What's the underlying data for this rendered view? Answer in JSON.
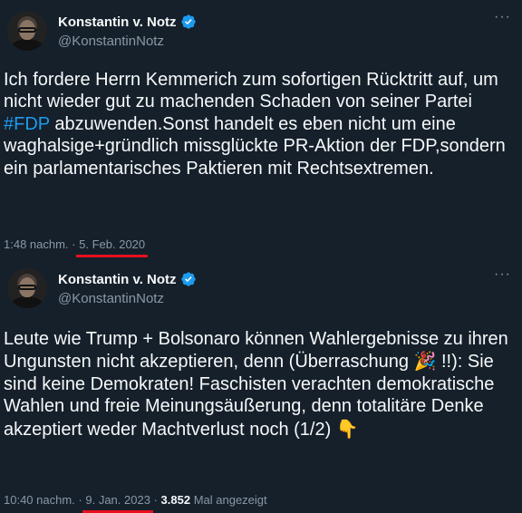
{
  "tweets": [
    {
      "author_name": "Konstantin v. Notz",
      "handle": "@KonstantinNotz",
      "more": "···",
      "text_part1": "Ich fordere Herrn Kemmerich zum sofortigen Rücktritt auf, um nicht wieder gut zu machenden Schaden von seiner Partei ",
      "hashtag": "#FDP",
      "text_part2": " abzuwenden.Sonst handelt es eben nicht um eine waghalsige+gründlich missglückte PR-Aktion der FDP,sondern ein parlamentarisches Paktieren mit Rechtsextremen.",
      "time": "1:48 nachm.",
      "sep": "·",
      "date": "5. Feb. 2020"
    },
    {
      "author_name": "Konstantin v. Notz",
      "handle": "@KonstantinNotz",
      "more": "···",
      "text_part1": "Leute wie Trump + Bolsonaro können Wahlergebnisse zu ihren Ungunsten nicht akzeptieren, denn (Überraschung ",
      "emoji1": "🎉",
      "text_part2": " !!): Sie sind keine Demokraten! Faschisten verachten demokratische Wahlen und freie Meinungsäußerung, denn totalitäre Denke akzeptiert weder Machtverlust noch (1/2) ",
      "emoji2": "👇",
      "time": "10:40 nachm.",
      "sep": "·",
      "date": "9. Jan. 2023",
      "sep2": "·",
      "views_count": "3.852",
      "views_label": "Mal angezeigt"
    }
  ],
  "colors": {
    "background": "#15202b",
    "text": "#f7f9f9",
    "secondary": "#8b98a5",
    "hashtag": "#1d9bf0",
    "verified": "#1d9bf0",
    "underline": "#e8101e"
  }
}
